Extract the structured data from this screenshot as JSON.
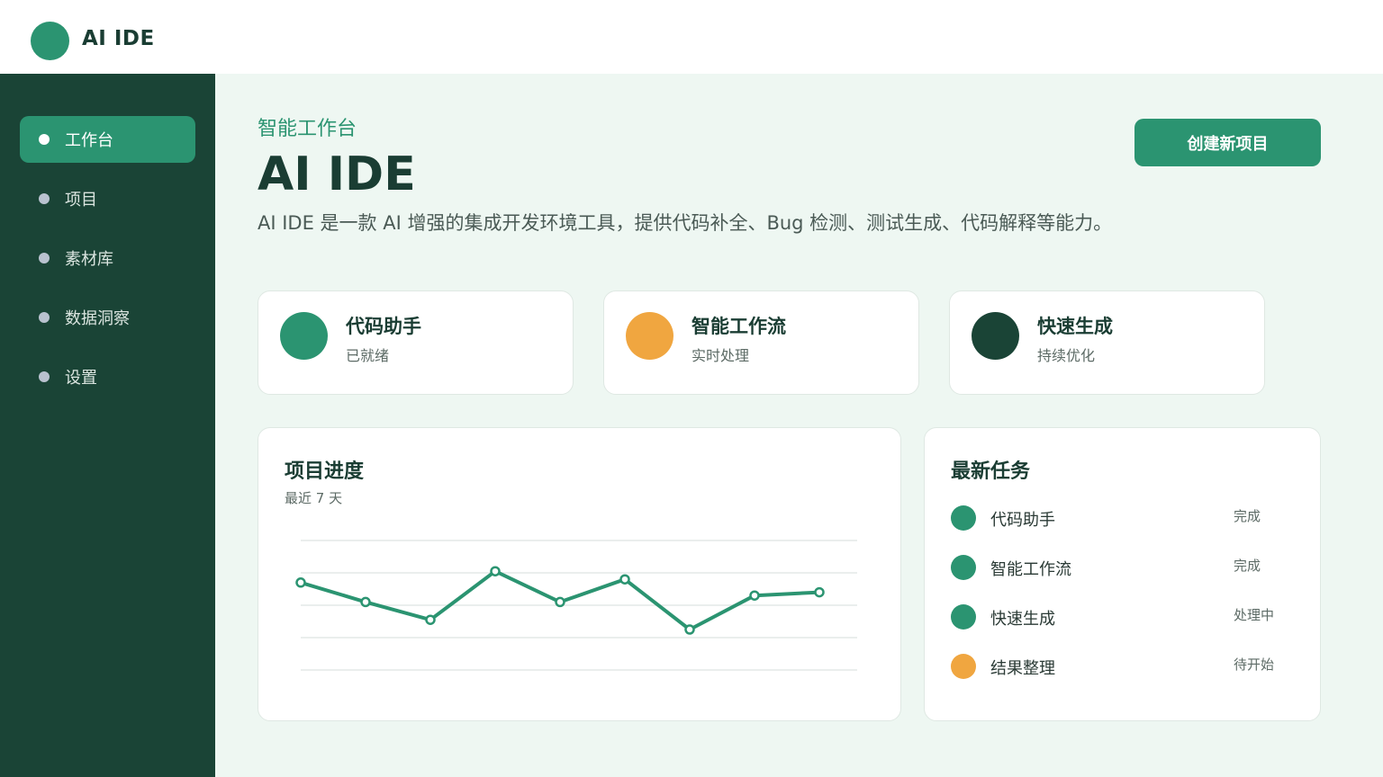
{
  "app": {
    "name": "AI IDE"
  },
  "colors": {
    "primary": "#2b9471",
    "accent": "#f0a640",
    "dark": "#1a4436"
  },
  "sidebar": {
    "items": [
      {
        "label": "工作台",
        "active": true
      },
      {
        "label": "项目",
        "active": false
      },
      {
        "label": "素材库",
        "active": false
      },
      {
        "label": "数据洞察",
        "active": false
      },
      {
        "label": "设置",
        "active": false
      }
    ]
  },
  "header": {
    "eyebrow": "智能工作台",
    "title": "AI IDE",
    "description": "AI IDE 是一款 AI 增强的集成开发环境工具，提供代码补全、Bug 检测、测试生成、代码解释等能力。",
    "create_button": "创建新项目"
  },
  "features": [
    {
      "title": "代码助手",
      "subtitle": "已就绪",
      "color": "#2b9471"
    },
    {
      "title": "智能工作流",
      "subtitle": "实时处理",
      "color": "#f0a640"
    },
    {
      "title": "快速生成",
      "subtitle": "持续优化",
      "color": "#1a4436"
    }
  ],
  "progress": {
    "title": "项目进度",
    "subtitle": "最近 7 天"
  },
  "chart_data": {
    "type": "line",
    "x": [
      1,
      2,
      3,
      4,
      5,
      6,
      7,
      8,
      9
    ],
    "series": [
      {
        "values": [
          54,
          42,
          31,
          61,
          42,
          56,
          25,
          46,
          48
        ],
        "color": "#2b9471"
      }
    ],
    "ylim": [
      0,
      80
    ],
    "grid": true,
    "title": "",
    "xlabel": "",
    "ylabel": ""
  },
  "tasks": {
    "title": "最新任务",
    "items": [
      {
        "name": "代码助手",
        "status": "完成",
        "color": "#2b9471"
      },
      {
        "name": "智能工作流",
        "status": "完成",
        "color": "#2b9471"
      },
      {
        "name": "快速生成",
        "status": "处理中",
        "color": "#2b9471"
      },
      {
        "name": "结果整理",
        "status": "待开始",
        "color": "#f0a640"
      }
    ]
  }
}
